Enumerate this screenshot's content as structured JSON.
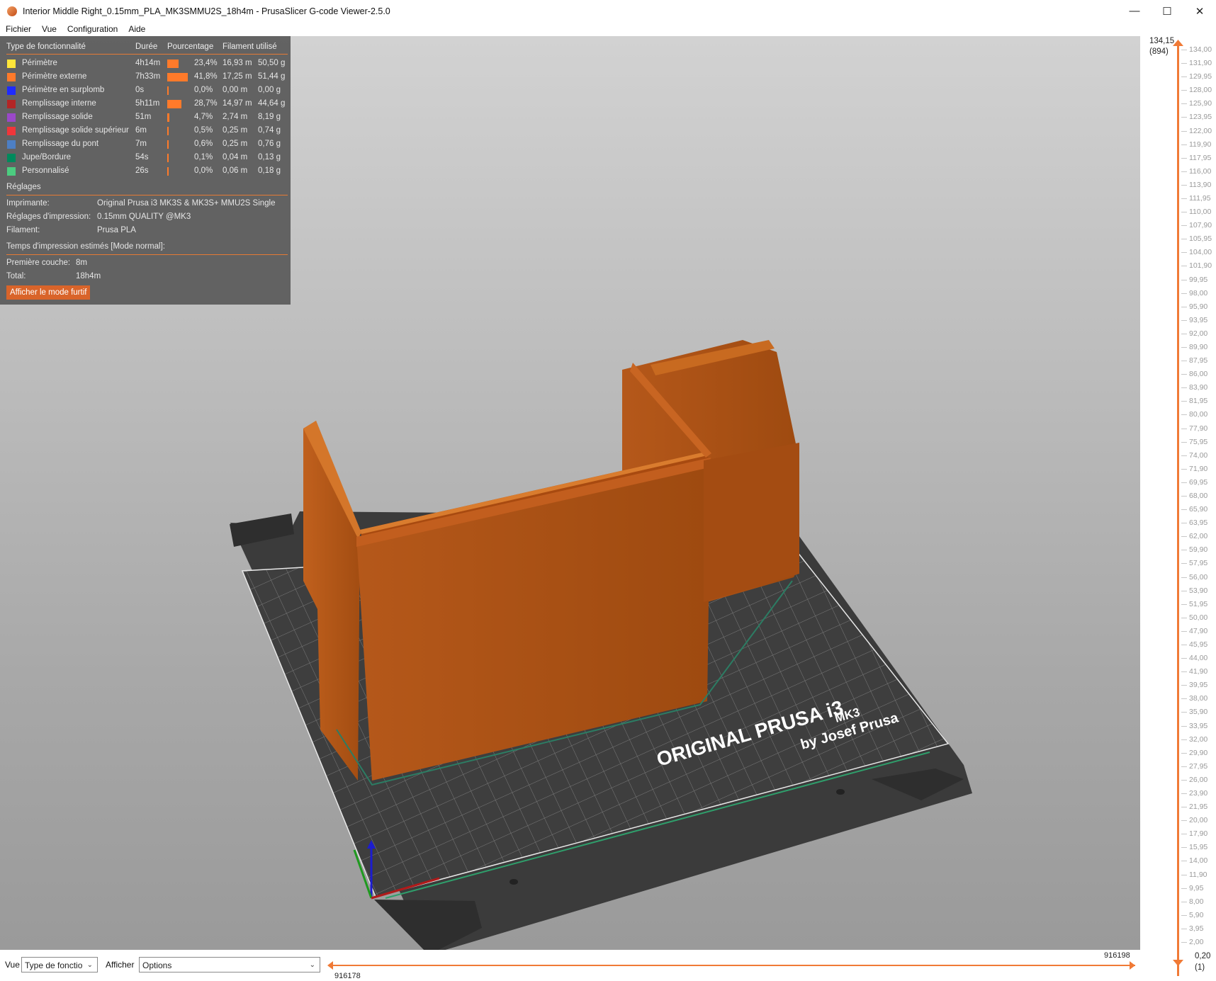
{
  "window": {
    "title": "Interior Middle Right_0.15mm_PLA_MK3SMMU2S_18h4m - PrusaSlicer G-code Viewer-2.5.0",
    "controls": [
      "minimize",
      "maximize",
      "close"
    ]
  },
  "menu": [
    "Fichier",
    "Vue",
    "Configuration",
    "Aide"
  ],
  "legend": {
    "headers": {
      "type": "Type de fonctionnalité",
      "time": "Durée",
      "pct": "Pourcentage",
      "filament": "Filament utilisé"
    },
    "rows": [
      {
        "name": "Périmètre",
        "time": "4h14m",
        "pct": "23,4%",
        "len": "16,93 m",
        "wt": "50,50 g",
        "color": "#ffe63a",
        "share": 0.234
      },
      {
        "name": "Périmètre externe",
        "time": "7h33m",
        "pct": "41,8%",
        "len": "17,25 m",
        "wt": "51,44 g",
        "color": "#ff7a2a",
        "share": 0.418
      },
      {
        "name": "Périmètre en surplomb",
        "time": "0s",
        "pct": "0,0%",
        "len": "0,00 m",
        "wt": "0,00 g",
        "color": "#1f2bff",
        "share": 0.0
      },
      {
        "name": "Remplissage interne",
        "time": "5h11m",
        "pct": "28,7%",
        "len": "14,97 m",
        "wt": "44,64 g",
        "color": "#b32626",
        "share": 0.287
      },
      {
        "name": "Remplissage solide",
        "time": "51m",
        "pct": "4,7%",
        "len": "2,74 m",
        "wt": "8,19 g",
        "color": "#9a48c9",
        "share": 0.047
      },
      {
        "name": "Remplissage solide supérieur",
        "time": "6m",
        "pct": "0,5%",
        "len": "0,25 m",
        "wt": "0,74 g",
        "color": "#f0363a",
        "share": 0.005
      },
      {
        "name": "Remplissage du pont",
        "time": "7m",
        "pct": "0,6%",
        "len": "0,25 m",
        "wt": "0,76 g",
        "color": "#4d7fc4",
        "share": 0.006
      },
      {
        "name": "Jupe/Bordure",
        "time": "54s",
        "pct": "0,1%",
        "len": "0,04 m",
        "wt": "0,13 g",
        "color": "#008a5c",
        "share": 0.001
      },
      {
        "name": "Personnalisé",
        "time": "26s",
        "pct": "0,0%",
        "len": "0,06 m",
        "wt": "0,18 g",
        "color": "#4ccc80",
        "share": 0.0
      }
    ],
    "settings_title": "Réglages",
    "settings": [
      {
        "label": "Imprimante:",
        "value": "Original Prusa i3 MK3S & MK3S+ MMU2S Single"
      },
      {
        "label": "Réglages d'impression:",
        "value": "0.15mm QUALITY @MK3"
      },
      {
        "label": "Filament:",
        "value": "Prusa PLA"
      }
    ],
    "times_title": "Temps d'impression estimés [Mode normal]:",
    "times": [
      {
        "label": "Première couche:",
        "value": "8m"
      },
      {
        "label": "Total:",
        "value": "18h4m"
      }
    ],
    "stealth_button": "Afficher le mode furtif"
  },
  "bed": {
    "brand": "ORIGINAL PRUSA i3",
    "model": "MK3",
    "byline": "by Josef Prusa"
  },
  "layer_slider": {
    "top_value": "134,15",
    "top_layer": "(894)",
    "bottom_value": "0,20",
    "bottom_layer": "(1)",
    "ticks": [
      "134,00",
      "131,90",
      "129,95",
      "128,00",
      "125,90",
      "123,95",
      "122,00",
      "119,90",
      "117,95",
      "116,00",
      "113,90",
      "111,95",
      "110,00",
      "107,90",
      "105,95",
      "104,00",
      "101,90",
      "99,95",
      "98,00",
      "95,90",
      "93,95",
      "92,00",
      "89,90",
      "87,95",
      "86,00",
      "83,90",
      "81,95",
      "80,00",
      "77,90",
      "75,95",
      "74,00",
      "71,90",
      "69,95",
      "68,00",
      "65,90",
      "63,95",
      "62,00",
      "59,90",
      "57,95",
      "56,00",
      "53,90",
      "51,95",
      "50,00",
      "47,90",
      "45,95",
      "44,00",
      "41,90",
      "39,95",
      "38,00",
      "35,90",
      "33,95",
      "32,00",
      "29,90",
      "27,95",
      "26,00",
      "23,90",
      "21,95",
      "20,00",
      "17,90",
      "15,95",
      "14,00",
      "11,90",
      "9,95",
      "8,00",
      "5,90",
      "3,95",
      "2,00"
    ]
  },
  "bottom": {
    "view_label": "Vue",
    "view_select": "Type de fonctio",
    "show_label": "Afficher",
    "show_select": "Options",
    "move_start": "916178",
    "move_end": "916198"
  }
}
